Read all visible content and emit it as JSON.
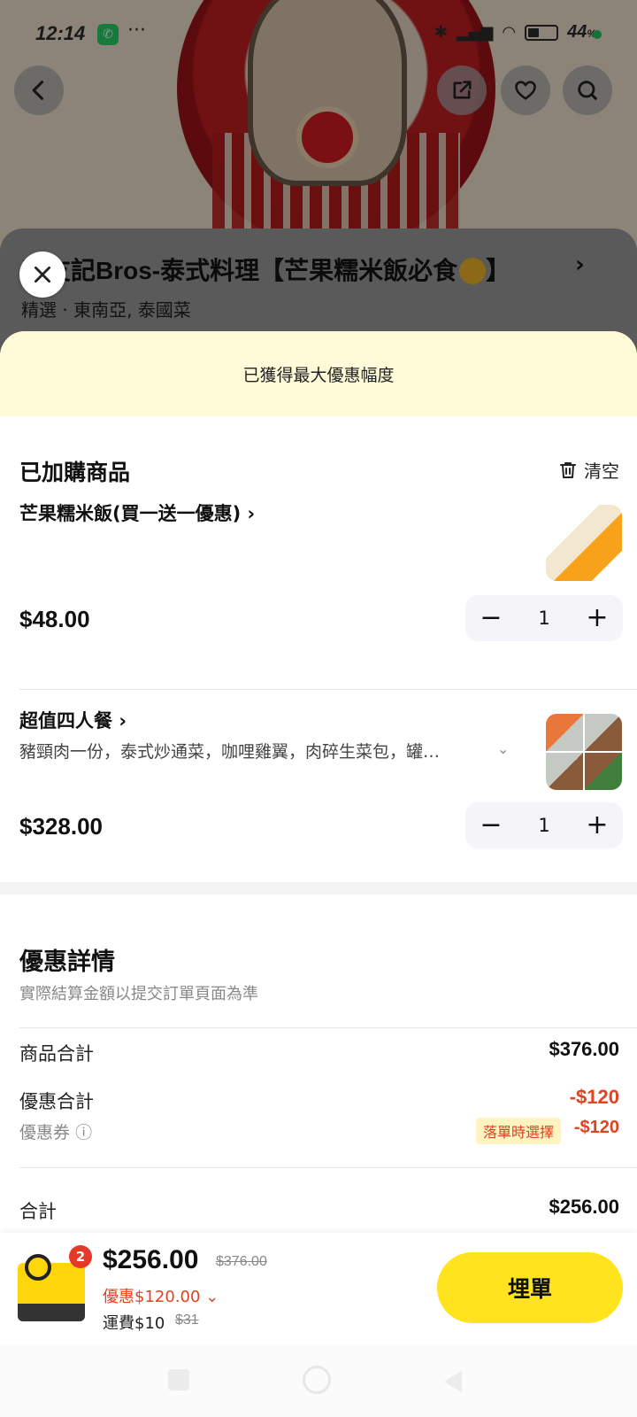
{
  "status_bar": {
    "time": "12:14",
    "dots": "···",
    "battery": "44"
  },
  "background": {
    "restaurant_title": "泰友記Bros-泰式料理【芒果糯米飯必食",
    "restaurant_tags": "精選 · 東南亞, 泰國菜"
  },
  "promo_banner": "已獲得最大優惠幅度",
  "cart": {
    "heading": "已加購商品",
    "clear_label": "清空",
    "items": [
      {
        "name": "芒果糯米飯(買一送一優惠)",
        "price": "$48.00",
        "qty": "1",
        "desc": ""
      },
      {
        "name": "超值四人餐",
        "price": "$328.00",
        "qty": "1",
        "desc": "豬頸肉一份，泰式炒通菜，咖哩雞翼，肉碎生菜包，罐…"
      }
    ]
  },
  "discount": {
    "heading": "優惠詳情",
    "subtitle": "實際結算金額以提交訂單頁面為準",
    "rows": [
      {
        "label": "商品合計",
        "value": "$376.00"
      },
      {
        "label": "優惠合計",
        "value": "-$120"
      }
    ],
    "coupon_label": "優惠券",
    "coupon_tag": "落單時選擇",
    "coupon_value": "-$120",
    "total_label": "合計",
    "total_value": "$256.00"
  },
  "checkout": {
    "badge": "2",
    "total": "$256.00",
    "original": "$376.00",
    "discount": "優惠$120.00",
    "fee": "運費$10",
    "fee_original": "$31",
    "pay_label": "埋單"
  },
  "colors": {
    "accent": "#ffe31c",
    "discount_red": "#e0431f",
    "banner": "#fffbd9"
  }
}
